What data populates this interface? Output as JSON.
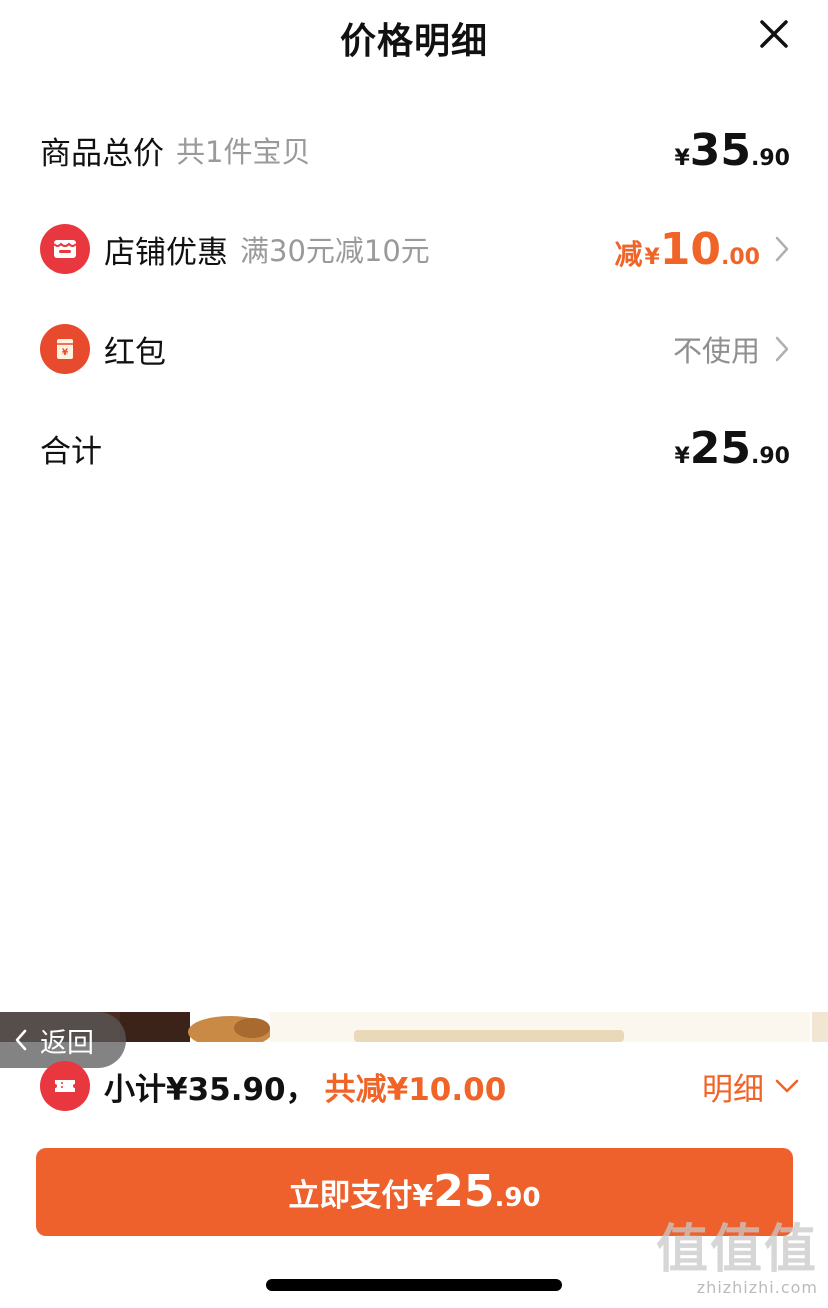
{
  "header": {
    "title": "价格明细"
  },
  "rows": {
    "goods_total": {
      "label": "商品总价",
      "sub": "共1件宝贝",
      "price": {
        "yen": "¥",
        "int": "35",
        "dec": ".90"
      }
    },
    "store_discount": {
      "label": "店铺优惠",
      "sub": "满30元减10元",
      "prefix": "减",
      "price": {
        "yen": "¥",
        "int": "10",
        "dec": ".00"
      }
    },
    "red_packet": {
      "label": "红包",
      "value": "不使用"
    },
    "total": {
      "label": "合计",
      "price": {
        "yen": "¥",
        "int": "25",
        "dec": ".90"
      }
    }
  },
  "back": {
    "label": "返回"
  },
  "summary": {
    "subtotal": "小计¥35.90，",
    "saved": "共减¥10.00",
    "detail_label": "明细"
  },
  "pay": {
    "label": "立即支付",
    "yen": "¥",
    "int": "25",
    "dec": ".90"
  },
  "watermark": {
    "main": "值值值",
    "sub": "zhizhizhi.com"
  },
  "colors": {
    "accent": "#f06428",
    "icon_red": "#e8373e",
    "pay_button": "#ee612c",
    "muted_text": "#9a9a9a"
  },
  "icons": {
    "close": "close-icon",
    "store": "store-icon",
    "red_packet": "red-packet-icon",
    "chevron_right": "chevron-right-icon",
    "chevron_left": "chevron-left-icon",
    "chevron_down": "chevron-down-icon",
    "coupon": "coupon-icon"
  }
}
